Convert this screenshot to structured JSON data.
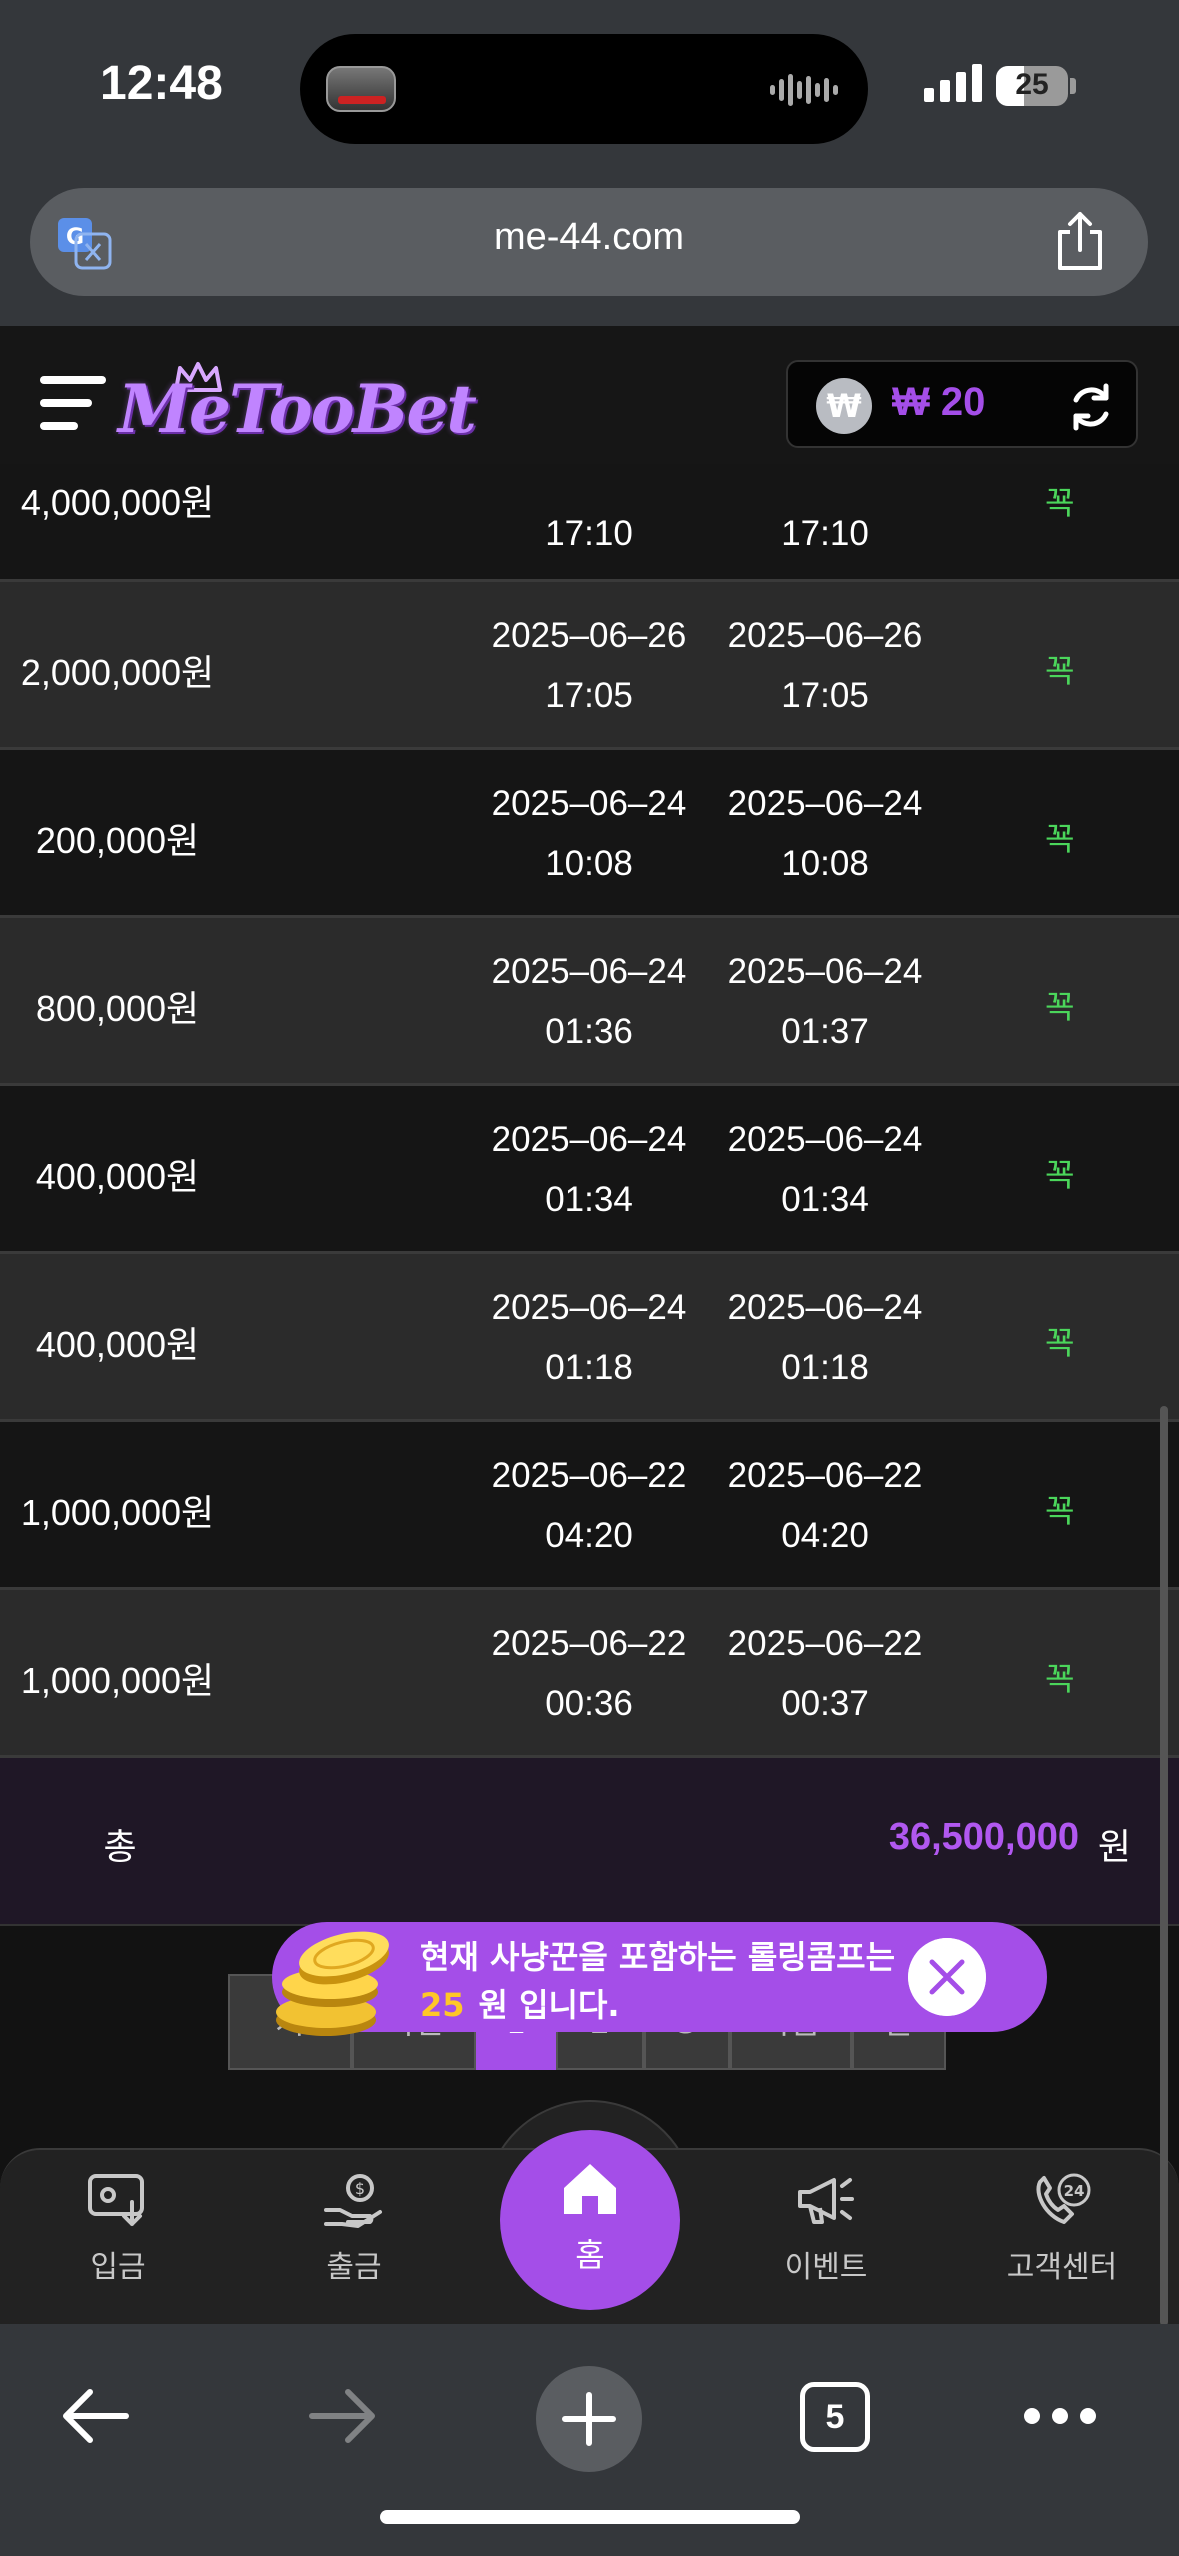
{
  "status_bar": {
    "time": "12:48",
    "battery": "25"
  },
  "browser": {
    "url": "me-44.com",
    "tab_count": "5"
  },
  "header": {
    "logo_text": "MeTooBet",
    "balance": "₩ 20",
    "currency_symbol": "₩"
  },
  "table": {
    "partial_top_row": {
      "amount": "4,000,000원",
      "request_time": "17:10",
      "process_time": "17:10",
      "status": "꾝"
    },
    "rows": [
      {
        "amount": "2,000,000원",
        "request_date": "2025–06–26",
        "request_time": "17:05",
        "process_date": "2025–06–26",
        "process_time": "17:05",
        "status": "꾝"
      },
      {
        "amount": "200,000원",
        "request_date": "2025–06–24",
        "request_time": "10:08",
        "process_date": "2025–06–24",
        "process_time": "10:08",
        "status": "꾝"
      },
      {
        "amount": "800,000원",
        "request_date": "2025–06–24",
        "request_time": "01:36",
        "process_date": "2025–06–24",
        "process_time": "01:37",
        "status": "꾝"
      },
      {
        "amount": "400,000원",
        "request_date": "2025–06–24",
        "request_time": "01:34",
        "process_date": "2025–06–24",
        "process_time": "01:34",
        "status": "꾝"
      },
      {
        "amount": "400,000원",
        "request_date": "2025–06–24",
        "request_time": "01:18",
        "process_date": "2025–06–24",
        "process_time": "01:18",
        "status": "꾝"
      },
      {
        "amount": "1,000,000원",
        "request_date": "2025–06–22",
        "request_time": "04:20",
        "process_date": "2025–06–22",
        "process_time": "04:20",
        "status": "꾝"
      },
      {
        "amount": "1,000,000원",
        "request_date": "2025–06–22",
        "request_time": "00:36",
        "process_date": "2025–06–22",
        "process_time": "00:37",
        "status": "꾝"
      }
    ],
    "total_label": "총",
    "total_value": "36,500,000",
    "total_unit": "원"
  },
  "pagination": [
    "처",
    "이전",
    "1",
    "2",
    "3",
    "다음",
    "끝"
  ],
  "toast": {
    "line1": "현재 사냥꾼을 포함하는 롤링콤프는",
    "amount": "25",
    "line2_suffix": "원 입니다."
  },
  "bottom_nav": {
    "deposit": "입금",
    "withdraw": "출금",
    "home": "홈",
    "event": "이벤트",
    "support": "고객센터"
  },
  "colors": {
    "accent": "#a44ee8",
    "status_green": "#4bd65b",
    "toast_amount": "#ffc727"
  }
}
